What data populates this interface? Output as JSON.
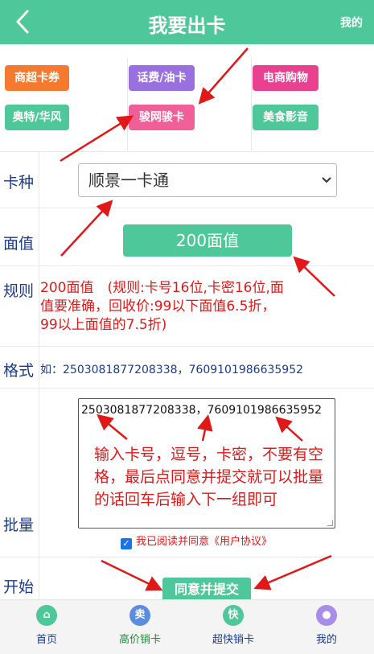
{
  "header": {
    "title": "我要出卡",
    "mine_label": "我的"
  },
  "categories": [
    {
      "label": "商超卡券",
      "color": "#f5792e"
    },
    {
      "label": "话费/油卡",
      "color": "#9a70e0"
    },
    {
      "label": "电商购物",
      "color": "#e9408f"
    },
    {
      "label": "奥特/华风",
      "color": "#4ec79a"
    },
    {
      "label": "骏网骏卡",
      "color": "#f05f97"
    },
    {
      "label": "美食影音",
      "color": "#4ec79a"
    }
  ],
  "form": {
    "card_type_label": "卡种",
    "card_type_value": "顺景一卡通",
    "amount_label": "面值",
    "amount_value": "200面值",
    "rules_label": "规则",
    "rules_text": "200面值　(规则:卡号16位,卡密16位,面值要准确，回收价:99以下面值6.5折，99以上面值的7.5折)",
    "format_label": "格式",
    "format_text": "如：2503081877208338，7609101986635952",
    "batch_label": "批量",
    "batch_value": "2503081877208338，7609101986635952",
    "batch_hint": "输入卡号，逗号，卡密，不要有空格，最后点同意并提交就可以批量的话回车后输入下一组即可",
    "agree_text": "我已阅读并同意《用户协议》",
    "start_label": "开始",
    "submit_label": "同意并提交"
  },
  "tabbar": [
    {
      "label": "首页",
      "icon": "home-icon",
      "glyph": "⌂",
      "icon_color": "#4ec79a",
      "label_color": "#1a3a8a"
    },
    {
      "label": "高价销卡",
      "icon": "sell-icon",
      "glyph": "卖",
      "icon_color": "#5a8de0",
      "label_color": "#1f8a3a"
    },
    {
      "label": "超快销卡",
      "icon": "fast-icon",
      "glyph": "快",
      "icon_color": "#4ec79a",
      "label_color": "#1a3a8a"
    },
    {
      "label": "我的",
      "icon": "user-icon",
      "glyph": "●",
      "icon_color": "#a98be8",
      "label_color": "#1a3a8a"
    }
  ]
}
